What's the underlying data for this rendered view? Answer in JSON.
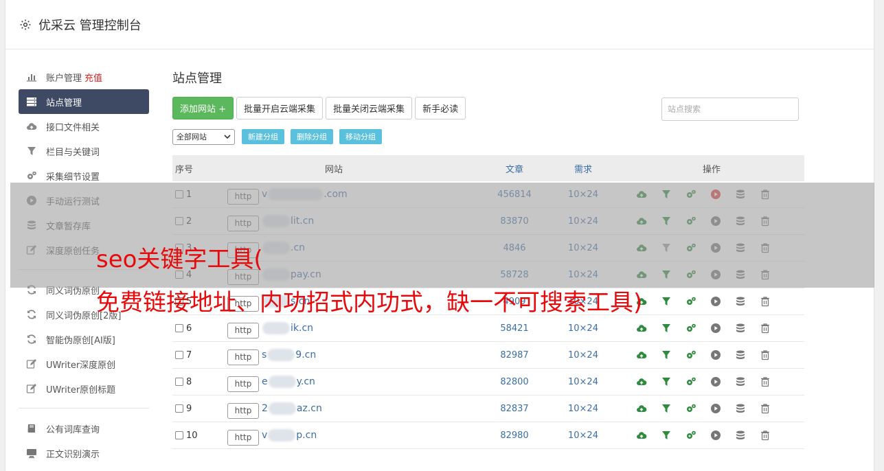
{
  "header": {
    "title": "优采云 管理控制台"
  },
  "sidebar": {
    "group1": [
      {
        "label": "账户管理",
        "extra": "充值",
        "icon": "bar-chart-icon",
        "active": false
      },
      {
        "label": "站点管理",
        "icon": "server-icon",
        "active": true
      },
      {
        "label": "接口文件相关",
        "icon": "cloud-upload-icon",
        "active": false
      },
      {
        "label": "栏目与关键词",
        "icon": "filter-icon",
        "active": false
      },
      {
        "label": "采集细节设置",
        "icon": "gears-icon",
        "active": false
      },
      {
        "label": "手动运行测试",
        "icon": "play-circle-icon",
        "active": false
      },
      {
        "label": "文章暂存库",
        "icon": "database-icon",
        "active": false
      },
      {
        "label": "深度原创任务",
        "icon": "edit-icon",
        "active": false
      }
    ],
    "group2": [
      {
        "label": "同义词伪原创",
        "icon": "refresh-icon"
      },
      {
        "label": "同义词伪原创[2版]",
        "icon": "refresh-icon"
      },
      {
        "label": "智能伪原创[AI版]",
        "icon": "refresh-icon"
      },
      {
        "label": "UWriter深度原创",
        "icon": "edit-icon"
      },
      {
        "label": "UWriter原创标题",
        "icon": "edit-icon"
      }
    ],
    "group3": [
      {
        "label": "公有词库查询",
        "icon": "book-icon"
      },
      {
        "label": "正文识别演示",
        "icon": "monitor-icon"
      }
    ]
  },
  "main": {
    "title": "站点管理",
    "toolbar": {
      "add_site": "添加网站 +",
      "batch_open": "批量开启云端采集",
      "batch_close": "批量关闭云端采集",
      "guide": "新手必读",
      "search_placeholder": "站点搜索"
    },
    "filter": {
      "select_value": "全部网站",
      "new_group": "新建分组",
      "delete_group": "删除分组",
      "move_group": "移动分组"
    },
    "table": {
      "headers": {
        "no": "序号",
        "site": "网站",
        "articles": "文章",
        "demand": "需求",
        "ops": "操作"
      },
      "rows": [
        {
          "no": "1",
          "prefix": "http",
          "domain_start": "v",
          "domain_end": ".com",
          "articles": "456814",
          "demand": "10×24",
          "play_active": true,
          "filter_active": true
        },
        {
          "no": "2",
          "prefix": "http",
          "domain_start": "",
          "domain_end": "lit.cn",
          "articles": "83870",
          "demand": "10×24",
          "play_active": false,
          "filter_active": true
        },
        {
          "no": "3",
          "prefix": "http",
          "domain_start": "",
          "domain_end": ".cn",
          "articles": "4846",
          "demand": "10×24",
          "play_active": false,
          "filter_active": false
        },
        {
          "no": "4",
          "prefix": "http",
          "domain_start": "",
          "domain_end": "pay.cn",
          "articles": "58728",
          "demand": "10×24",
          "play_active": false,
          "filter_active": true
        },
        {
          "no": "5",
          "prefix": "http",
          "domain_start": "",
          "domain_end": "s.cn",
          "articles": "4909",
          "demand": "10×24",
          "play_active": false,
          "filter_active": true
        },
        {
          "no": "6",
          "prefix": "http",
          "domain_start": "",
          "domain_end": "ik.cn",
          "articles": "58421",
          "demand": "10×24",
          "play_active": false,
          "filter_active": true
        },
        {
          "no": "7",
          "prefix": "http",
          "domain_start": "s",
          "domain_end": "9.cn",
          "articles": "82987",
          "demand": "10×24",
          "play_active": false,
          "filter_active": true
        },
        {
          "no": "8",
          "prefix": "http",
          "domain_start": "e",
          "domain_end": "y.cn",
          "articles": "82800",
          "demand": "10×24",
          "play_active": false,
          "filter_active": true
        },
        {
          "no": "9",
          "prefix": "http",
          "domain_start": "2",
          "domain_end": "az.cn",
          "articles": "82837",
          "demand": "10×24",
          "play_active": false,
          "filter_active": true
        },
        {
          "no": "10",
          "prefix": "http",
          "domain_start": "v",
          "domain_end": "p.cn",
          "articles": "82980",
          "demand": "10×24",
          "play_active": false,
          "filter_active": true
        }
      ]
    }
  },
  "overlay": {
    "line1": "seo关键字工具(",
    "line2": "免费链接地址、内功招式内功式，缺一不可搜索工具)"
  },
  "colors": {
    "sidebar_active": "#3e4a63",
    "green": "#5cb85c",
    "info": "#5bc0de",
    "link": "#3a6ea5",
    "overlay_text": "#e8090b",
    "icon_green": "#2e8b3e",
    "icon_red": "#e03a3a"
  }
}
